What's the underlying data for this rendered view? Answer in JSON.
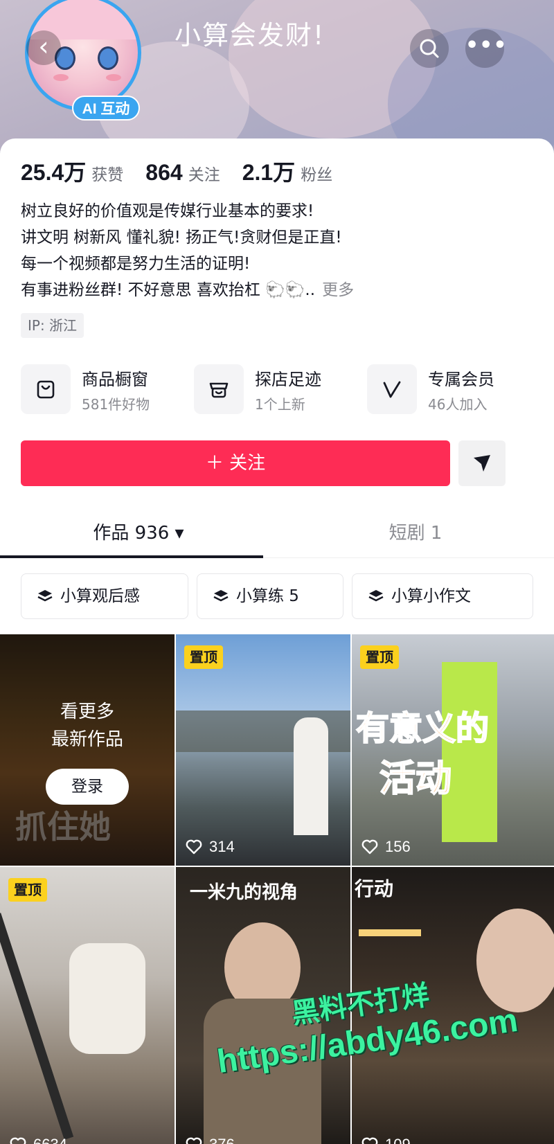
{
  "header": {
    "title": "小算会发财!",
    "ai_badge": "AI 互动",
    "back_icon": "chevron-left-icon",
    "search_icon": "search-icon",
    "more_icon": "more-icon"
  },
  "stats": [
    {
      "value": "25.4万",
      "label": "获赞"
    },
    {
      "value": "864",
      "label": "关注"
    },
    {
      "value": "2.1万",
      "label": "粉丝"
    }
  ],
  "bio": {
    "lines": [
      "树立良好的价值观是传媒行业基本的要求!",
      "讲文明 树新风 懂礼貌! 扬正气!贪财但是正直!",
      "每一个视频都是努力生活的证明!",
      "有事进粉丝群! 不好意思 喜欢抬杠 🐑🐑.."
    ],
    "more": "更多"
  },
  "ip": "IP: 浙江",
  "features": [
    {
      "name": "商品橱窗",
      "sub": "581件好物",
      "icon": "shopping-bag-icon"
    },
    {
      "name": "探店足迹",
      "sub": "1个上新",
      "icon": "store-icon"
    },
    {
      "name": "专属会员",
      "sub": "46人加入",
      "icon": "v-icon"
    }
  ],
  "actions": {
    "follow": "＋ 关注",
    "share_icon": "send-icon"
  },
  "tabs": [
    {
      "label": "作品 936 ▾"
    },
    {
      "label": "短剧 1"
    }
  ],
  "collections": [
    "小算观后感",
    "小算练 5",
    "小算小作文"
  ],
  "login_overlay": {
    "title_line1": "看更多",
    "title_line2": "最新作品",
    "button": "登录",
    "bg_text": "抓住她"
  },
  "videos": [
    {
      "pinned": "置顶",
      "likes": "314"
    },
    {
      "pinned": "置顶",
      "likes": "156",
      "overlay_line1": "有意义的",
      "overlay_line2": "活动"
    },
    {
      "pinned": "置顶",
      "likes": "6634"
    },
    {
      "likes": "376",
      "overlay": "一米九的视角"
    },
    {
      "likes": "109",
      "overlay": "行动"
    }
  ],
  "watermark": {
    "line1": "黑料不打烊",
    "line2": "https://abdy46.com"
  },
  "colors": {
    "accent": "#fe2c55",
    "ai_badge": "#3aa5f0",
    "pin": "#fbd11e",
    "watermark": "#3cf2a0"
  }
}
